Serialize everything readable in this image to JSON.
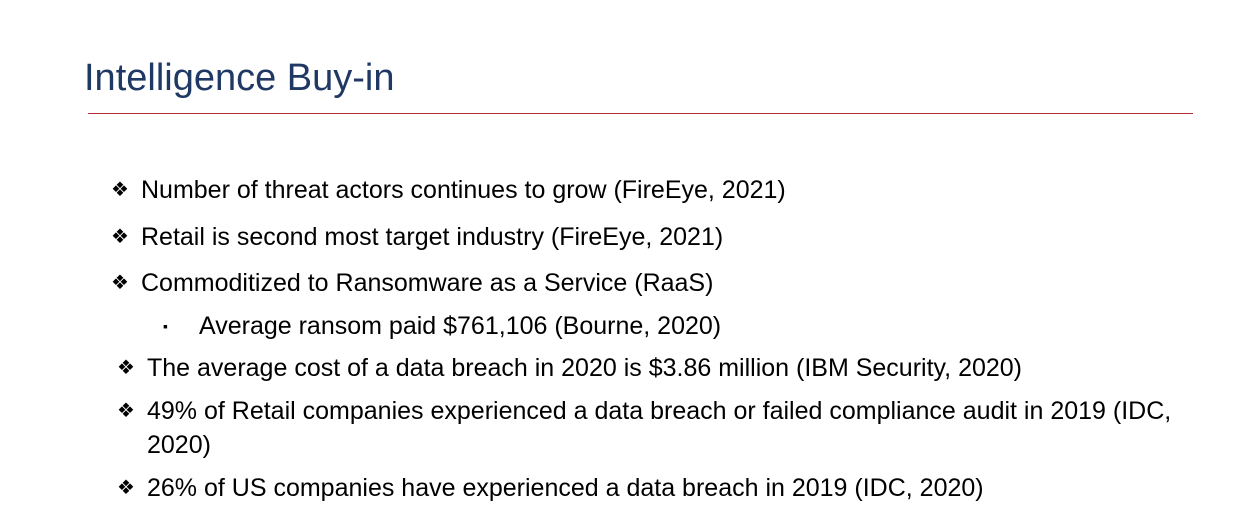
{
  "slide": {
    "title": "Intelligence Buy-in",
    "colors": {
      "title": "#1f3864",
      "divider": "#b22d35",
      "text": "#000000"
    },
    "bullet_marker": "❖",
    "sub_marker": "▪",
    "bullets": [
      {
        "level": 1,
        "text": "Number of threat actors continues to grow (FireEye, 2021)"
      },
      {
        "level": 1,
        "text": "Retail is second most target industry (FireEye, 2021)"
      },
      {
        "level": 1,
        "text": "Commoditized to Ransomware as a Service (RaaS)"
      },
      {
        "level": 2,
        "text": "Average ransom paid $761,106 (Bourne, 2020)"
      },
      {
        "level": 1,
        "text": "The average cost of a data breach in 2020 is $3.86 million (IBM Security, 2020)"
      },
      {
        "level": 1,
        "text": "49% of Retail companies experienced a data breach or failed compliance audit in 2019 (IDC, 2020)"
      },
      {
        "level": 1,
        "text": "26% of US companies have experienced a data breach in 2019 (IDC, 2020)"
      }
    ]
  }
}
